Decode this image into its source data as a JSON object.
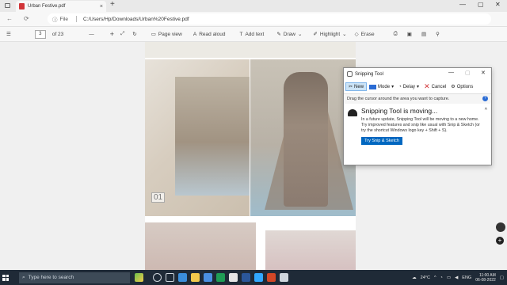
{
  "browser": {
    "tab_title": "Urban Festive.pdf",
    "tab_close": "×",
    "new_tab": "+",
    "window_controls": [
      "—",
      "▢",
      "✕"
    ],
    "url_prefix": "File",
    "url": "C:/Users/Hp/Downloads/Urban%20Festive.pdf"
  },
  "pdf_toolbar": {
    "page_current": "3",
    "page_total": "of 23",
    "zoom_out": "—",
    "zoom_in": "+",
    "page_view": "Page view",
    "read_aloud": "Read aloud",
    "add_text": "Add text",
    "draw": "Draw",
    "highlight": "Highlight",
    "erase": "Erase"
  },
  "document": {
    "page_number_mark": "01"
  },
  "snipping_tool": {
    "title": "Snipping Tool",
    "window_controls": [
      "—",
      "▢",
      "✕"
    ],
    "new_label": "New",
    "mode_label": "Mode",
    "delay_label": "Delay",
    "cancel_label": "Cancel",
    "options_label": "Options",
    "hint": "Drag the cursor around the area you want to capture.",
    "help": "?",
    "notice_title": "Snipping Tool is moving...",
    "notice_body": "In a future update, Snipping Tool will be moving to a new home. Try improved features and snip like usual with Snip & Sketch (or try the shortcut Windows logo key + Shift + S).",
    "try_button": "Try Snip & Sketch",
    "collapse": "^"
  },
  "taskbar": {
    "search_placeholder": "Type here to search",
    "temperature": "24°C",
    "language": "ENG",
    "time": "11:00 AM",
    "date": "06-08-2022"
  },
  "colors": {
    "taskbar_bg": "#1f2a37",
    "accent": "#0067c0",
    "pdf_icon": "#d13438"
  }
}
